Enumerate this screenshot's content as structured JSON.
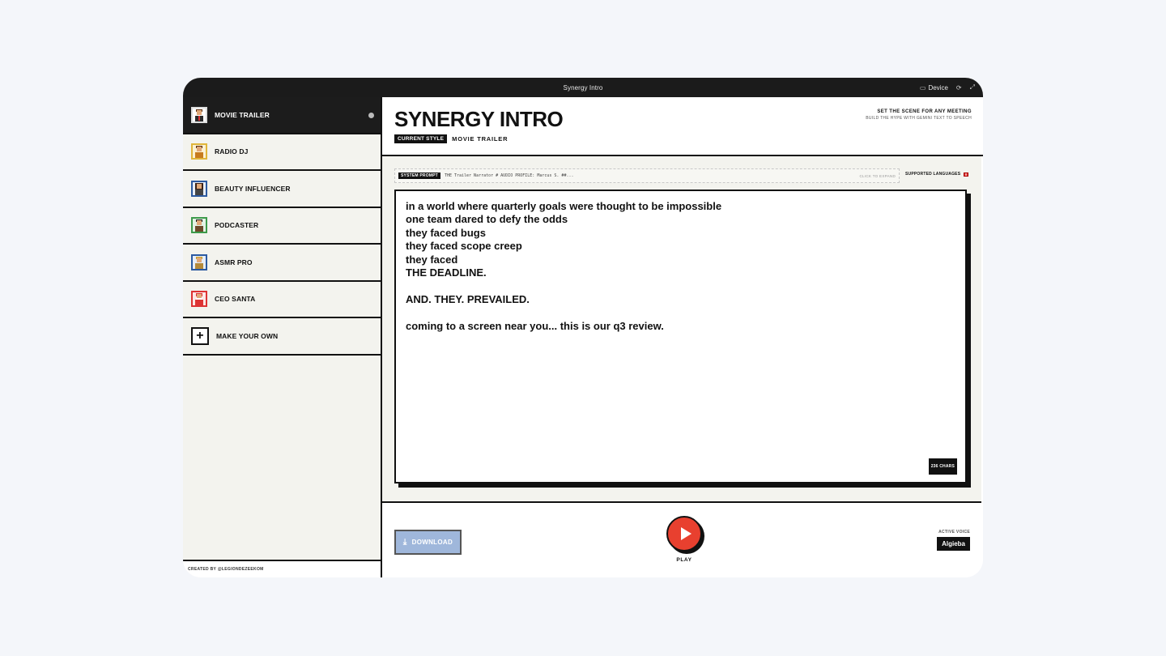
{
  "window": {
    "title": "Synergy Intro",
    "device_label": "Device",
    "device_icon": "monitor-icon",
    "refresh_icon": "refresh-icon",
    "fullscreen_icon": "fullscreen-icon"
  },
  "sidebar": {
    "items": [
      {
        "label": "MOVIE TRAILER",
        "icon": "movie-trailer-avatar-icon"
      },
      {
        "label": "RADIO DJ",
        "icon": "radio-dj-avatar-icon"
      },
      {
        "label": "BEAUTY INFLUENCER",
        "icon": "beauty-influencer-avatar-icon"
      },
      {
        "label": "PODCASTER",
        "icon": "podcaster-avatar-icon"
      },
      {
        "label": "ASMR PRO",
        "icon": "asmr-pro-avatar-icon"
      },
      {
        "label": "CEO SANTA",
        "icon": "ceo-santa-avatar-icon"
      },
      {
        "label": "MAKE YOUR OWN",
        "icon": "plus-icon"
      }
    ],
    "footer": "CREATED BY @LEGIONDEZEEKOM"
  },
  "header": {
    "title": "SYNERGY INTRO",
    "style_badge": "CURRENT STYLE",
    "style_value": "MOVIE TRAILER",
    "tagline_1": "SET THE SCENE FOR ANY MEETING",
    "tagline_2": "BUILD THE HYPE WITH GEMINI TEXT TO SPEECH"
  },
  "system_prompt": {
    "badge": "SYSTEM PROMPT",
    "preview": "THE Trailer Narrator # AUDIO PROFILE: Marcus S. ##...",
    "expand_label": "CLICK TO EXPAND",
    "languages_label": "SUPPORTED LANGUAGES"
  },
  "script": {
    "lines": [
      "in a world where quarterly goals were thought to be impossible",
      "one team dared to defy the odds",
      "they faced bugs",
      "they faced scope creep",
      "they faced",
      "THE DEADLINE.",
      "",
      "AND. THEY. PREVAILED.",
      "",
      "coming to a screen near you... this is our q3 review."
    ],
    "char_count": "236 CHARS"
  },
  "controls": {
    "download_label": "DOWNLOAD",
    "play_label": "PLAY",
    "active_voice_label": "ACTIVE VOICE",
    "active_voice_value": "Algieba"
  },
  "colors": {
    "accent_play": "#e8402f",
    "download_bg": "#9fb7db",
    "dark": "#1c1c1c"
  }
}
